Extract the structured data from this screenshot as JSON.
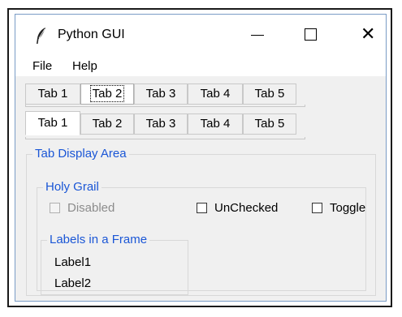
{
  "window": {
    "title": "Python GUI"
  },
  "menu": {
    "items": [
      "File",
      "Help"
    ]
  },
  "tabs_top": {
    "labels": [
      "Tab 1",
      "Tab 2",
      "Tab 3",
      "Tab 4",
      "Tab 5"
    ],
    "selected": "Tab 2"
  },
  "tabs_bottom": {
    "labels": [
      "Tab 1",
      "Tab 2",
      "Tab 3",
      "Tab 4",
      "Tab 5"
    ],
    "selected": "Tab 1"
  },
  "display_area": {
    "label": "Tab Display Area"
  },
  "holy_grail": {
    "label": "Holy Grail",
    "checkboxes": [
      {
        "label": "Disabled",
        "checked": false,
        "enabled": false
      },
      {
        "label": "UnChecked",
        "checked": false,
        "enabled": true
      },
      {
        "label": "Toggle",
        "checked": false,
        "enabled": true
      }
    ]
  },
  "labels_frame": {
    "label": "Labels in a Frame",
    "labels": [
      "Label1",
      "Label2"
    ]
  },
  "colors": {
    "accent": "#1a56d6",
    "window_bg": "#f0f0f0",
    "titlebar_bg": "#ffffff"
  }
}
